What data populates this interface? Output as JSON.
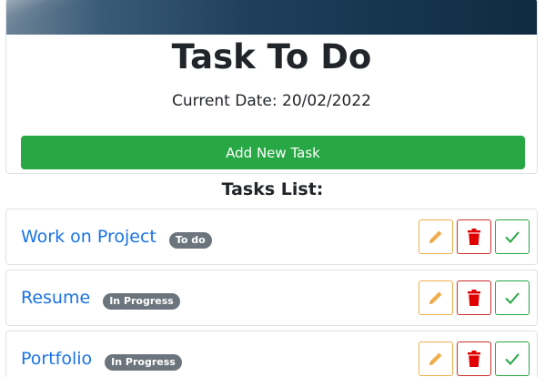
{
  "header": {
    "title": "Task To Do",
    "date_label": "Current Date: 20/02/2022",
    "add_button_label": "Add New Task"
  },
  "list": {
    "heading": "Tasks List:",
    "tasks": [
      {
        "name": "Work on Project",
        "status": "To do"
      },
      {
        "name": "Resume",
        "status": "In Progress"
      },
      {
        "name": "Portfolio",
        "status": "In Progress"
      }
    ]
  },
  "icons": {
    "edit": "pencil-icon",
    "delete": "trash-icon",
    "done": "check-icon"
  },
  "colors": {
    "primary_link": "#1a73e8",
    "add_button": "#28a745",
    "badge": "#6c757d",
    "edit": "#f0ad4e",
    "delete": "#e00000",
    "done": "#28a745"
  }
}
